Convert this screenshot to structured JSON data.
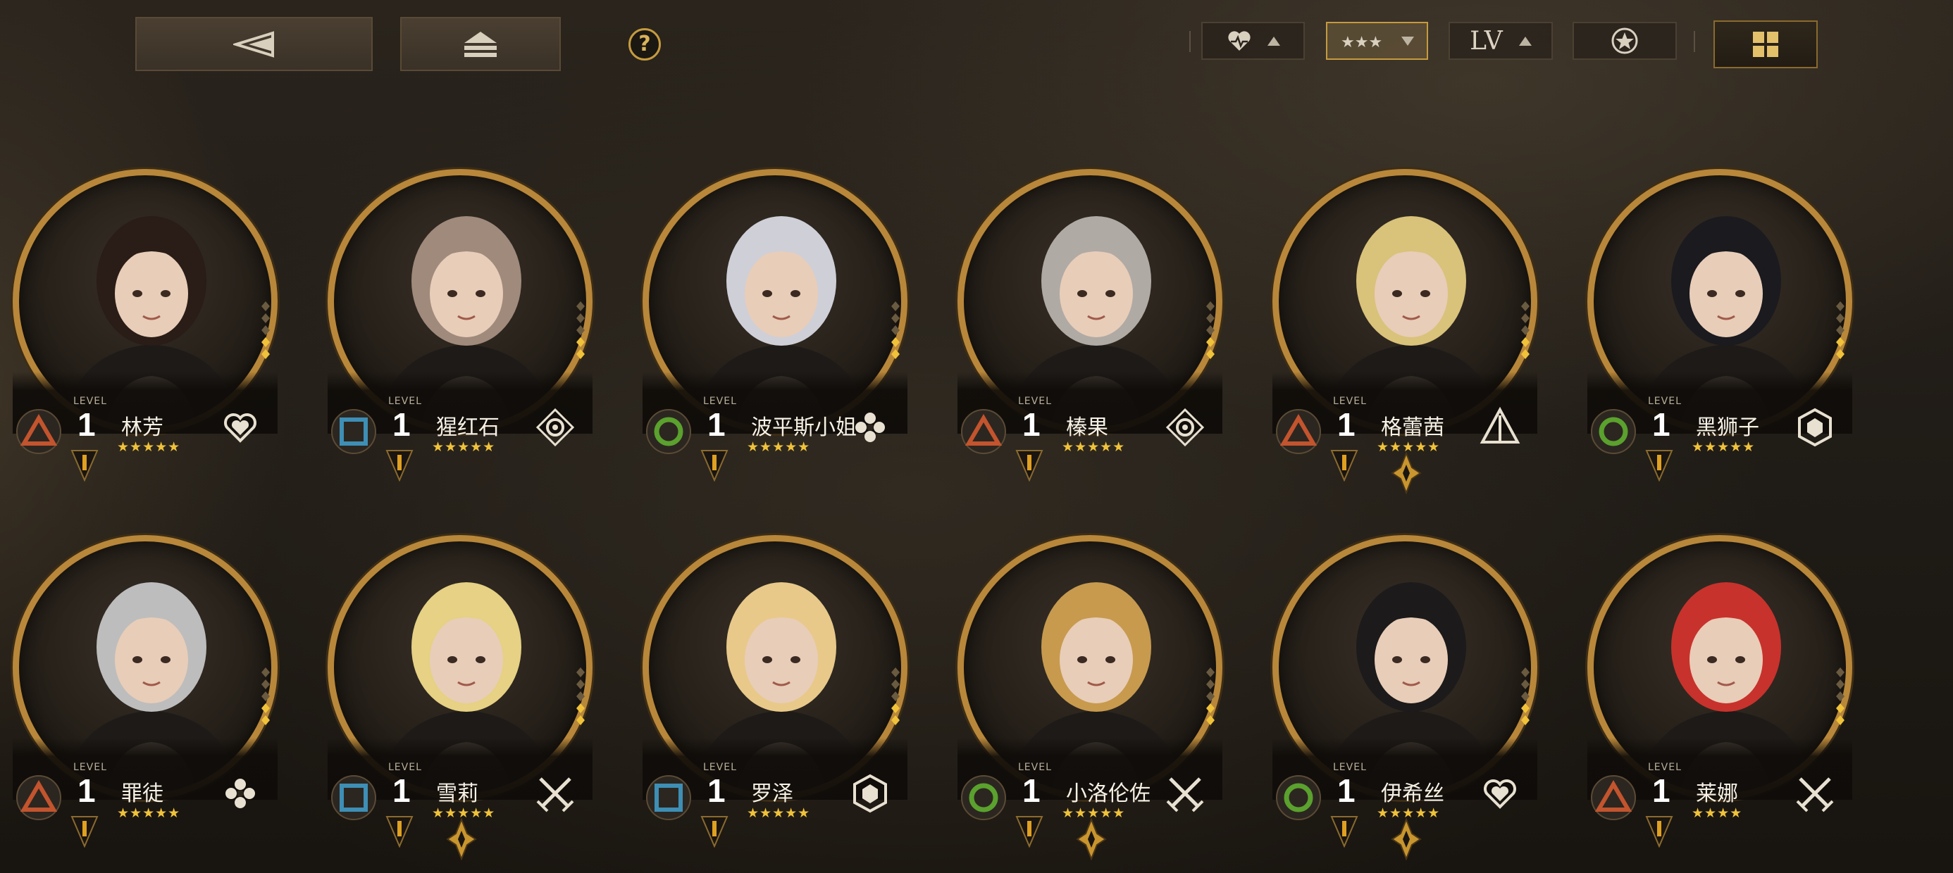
{
  "topbar": {
    "back_icon": "back-triangle-icon",
    "eject_icon": "eject-icon",
    "help_label": "?",
    "filters": [
      {
        "icon": "heart-icon",
        "direction": "up",
        "active": false
      },
      {
        "icon": "stars-icon",
        "direction": "down",
        "active": true
      },
      {
        "label": "LV",
        "direction": "up",
        "active": false
      },
      {
        "icon": "star-badge-icon",
        "active": false
      }
    ],
    "view_icon": "grid-view-icon"
  },
  "level_label": "LEVEL",
  "rank_label": "I",
  "characters": [
    {
      "name": "林芳",
      "level": "1",
      "stars": "★★★★★",
      "element": "triangle",
      "role": "heart-role-icon",
      "diamond": false
    },
    {
      "name": "猩红石",
      "level": "1",
      "stars": "★★★★★",
      "element": "square",
      "role": "target-role-icon",
      "diamond": false
    },
    {
      "name": "波平斯小姐",
      "level": "1",
      "stars": "★★★★★",
      "element": "circle",
      "role": "flower-role-icon",
      "diamond": false
    },
    {
      "name": "榛果",
      "level": "1",
      "stars": "★★★★★",
      "element": "triangle",
      "role": "target-role-icon",
      "diamond": false
    },
    {
      "name": "格蕾茜",
      "level": "1",
      "stars": "★★★★★",
      "element": "triangle",
      "role": "tent-role-icon",
      "diamond": true
    },
    {
      "name": "黑狮子",
      "level": "1",
      "stars": "★★★★★",
      "element": "circle",
      "role": "hex-role-icon",
      "diamond": false
    },
    {
      "name": "罪徒",
      "level": "1",
      "stars": "★★★★★",
      "element": "triangle",
      "role": "flower-role-icon",
      "diamond": false
    },
    {
      "name": "雪莉",
      "level": "1",
      "stars": "★★★★★",
      "element": "square",
      "role": "swords-role-icon",
      "diamond": true
    },
    {
      "name": "罗泽",
      "level": "1",
      "stars": "★★★★★",
      "element": "square",
      "role": "hex-role-icon",
      "diamond": false
    },
    {
      "name": "小洛伦佐",
      "level": "1",
      "stars": "★★★★★",
      "element": "circle",
      "role": "swords-role-icon",
      "diamond": true
    },
    {
      "name": "伊希丝",
      "level": "1",
      "stars": "★★★★★",
      "element": "circle",
      "role": "heart-role-icon",
      "diamond": true
    },
    {
      "name": "莱娜",
      "level": "1",
      "stars": "★★★★",
      "element": "triangle",
      "role": "swords-role-icon",
      "diamond": false
    }
  ],
  "colors": {
    "gold": "#b8873a",
    "star": "#f0c23a",
    "triangle": "#c2542e",
    "square": "#3e8fb5",
    "circle": "#5aa12e"
  }
}
